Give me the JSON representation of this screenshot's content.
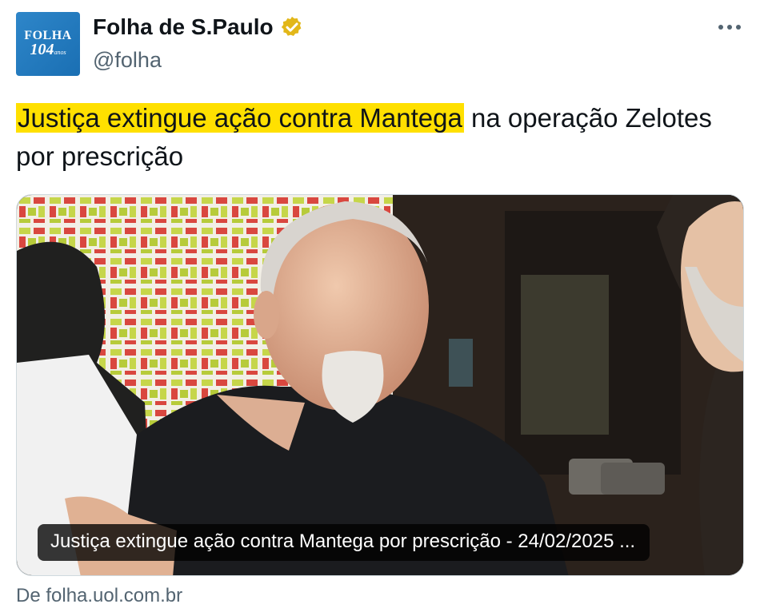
{
  "account": {
    "avatar_line1": "FOLHA",
    "avatar_line2": "104",
    "avatar_line2_suffix": "anos",
    "display_name": "Folha de S.Paulo",
    "handle": "@folha",
    "verified_icon": "gold-verified-badge-icon"
  },
  "menu_icon": "more-options-icon",
  "tweet": {
    "highlighted_text": "Justiça extingue ação contra Mantega",
    "rest_text": " na operação Zelotes por prescrição"
  },
  "card": {
    "caption": "Justiça extingue ação contra Mantega por prescrição - 24/02/2025 ...",
    "source": "De folha.uol.com.br"
  },
  "colors": {
    "highlight": "#ffe000",
    "verified_gold": "#e2b719",
    "muted_text": "#536471",
    "avatar_blue": "#2479c0"
  }
}
